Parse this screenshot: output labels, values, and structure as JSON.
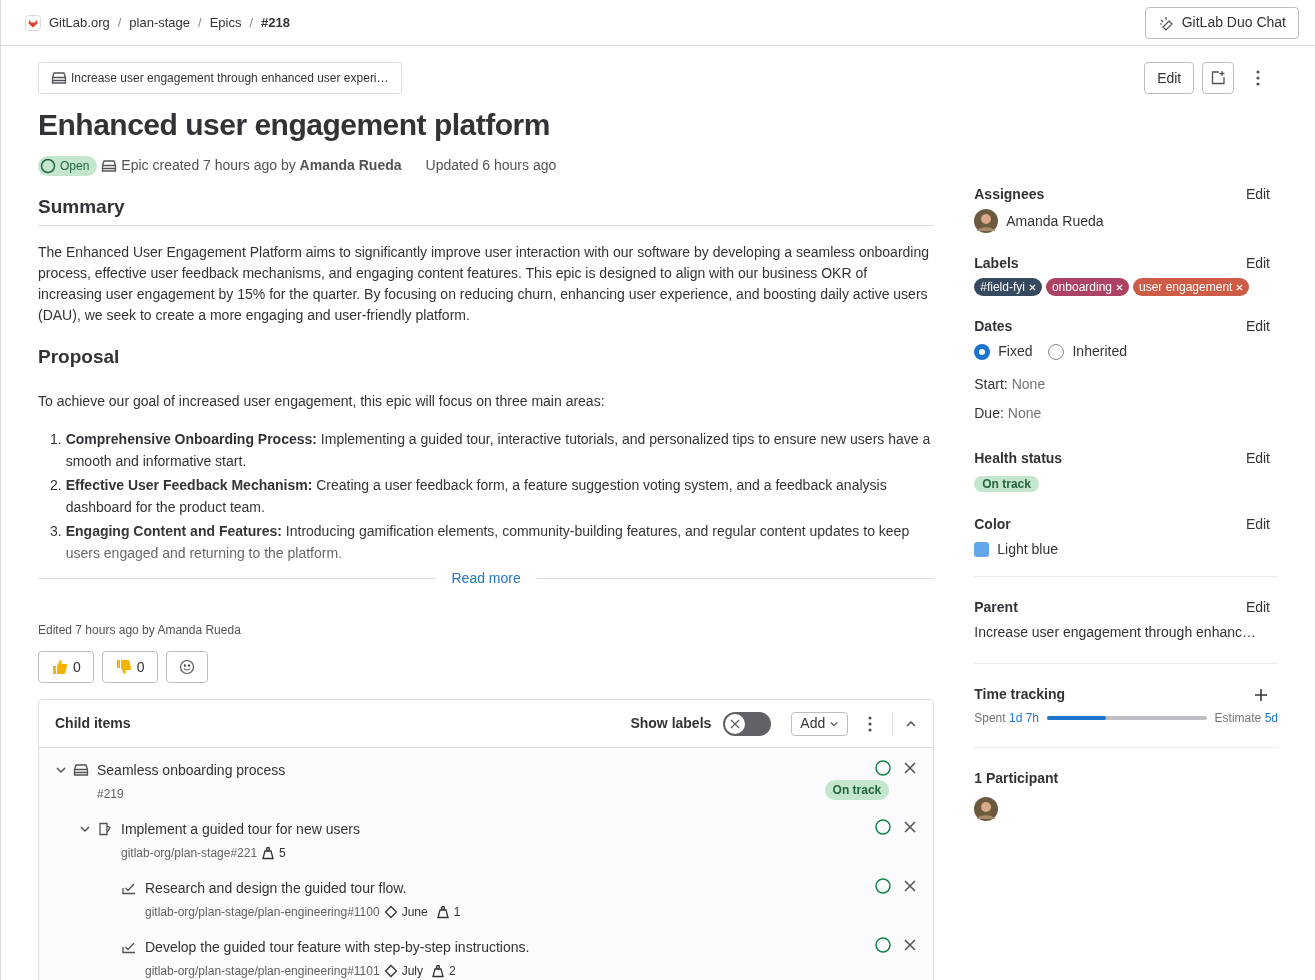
{
  "breadcrumbs": [
    {
      "label": "GitLab.org",
      "kind": "group"
    },
    {
      "label": "plan-stage",
      "kind": "link"
    },
    {
      "label": "Epics",
      "kind": "link"
    },
    {
      "label": "#218",
      "kind": "current"
    }
  ],
  "breadcrumb_separator": "/",
  "duo_button": "GitLab Duo Chat",
  "parent_chip": "Increase user engagement through enhanced user experi…",
  "actions": {
    "edit": "Edit"
  },
  "title": "Enhanced user engagement platform",
  "status": {
    "label": "Open"
  },
  "meta": {
    "created": "Epic created 7 hours ago by **Amanda Rueda**",
    "updated": "Updated 6 hours ago"
  },
  "description": [
    {
      "kind": "heading",
      "text": "Summary",
      "divider": true
    },
    {
      "kind": "paragraph",
      "text": "The Enhanced User Engagement Platform aims to significantly improve user interaction with our software by developing a seamless onboarding process, effective user feedback mechanisms, and engaging content features. This epic is designed to align with our business OKR of increasing user engagement by 15% for the quarter. By focusing on reducing churn, enhancing user experience, and boosting daily active users (DAU), we seek to create a more engaging and user-friendly platform."
    },
    {
      "kind": "heading",
      "text": "Proposal",
      "divider": false
    },
    {
      "kind": "paragraph",
      "text": "To achieve our goal of increased user engagement, this epic will focus on three main areas:"
    },
    {
      "kind": "list",
      "items": [
        {
          "num": "1.",
          "text": "**Comprehensive Onboarding Process:** Implementing a guided tour, interactive tutorials, and personalized tips to ensure new users have a smooth and informative start."
        },
        {
          "num": "2.",
          "text": "**Effective User Feedback Mechanism:** Creating a user feedback form, a feature suggestion voting system, and a feedback analysis dashboard for the product team."
        },
        {
          "num": "3.",
          "text": "**Engaging Content and Features:** Introducing gamification elements, community-building features, and regular content updates to keep users engaged and returning to the platform."
        }
      ]
    }
  ],
  "read_more": "Read more",
  "edited": "Edited 7 hours ago by Amanda Rueda",
  "reactions": [
    {
      "kind": "thumbsup",
      "count": "0"
    },
    {
      "kind": "thumbsdown",
      "count": "0"
    },
    {
      "kind": "add"
    }
  ],
  "child_items": {
    "title": "Child items",
    "show_labels": {
      "label": "Show labels",
      "on": false
    },
    "add": "Add",
    "items": [
      {
        "kind": "epic",
        "title": "Seamless onboarding process",
        "ref": "#219",
        "health": "On track",
        "expanded": true,
        "children": [
          {
            "kind": "issue",
            "title": "Implement a guided tour for new users",
            "ref": "gitlab-org/plan-stage#221",
            "weight": "5",
            "expanded": true,
            "children": [
              {
                "kind": "task",
                "title": "Research and design the guided tour flow.",
                "ref": "gitlab-org/plan-stage/plan-engineering#1100",
                "milestone": "June",
                "weight": "1"
              },
              {
                "kind": "task",
                "title": "Develop the guided tour feature with step-by-step instructions.",
                "ref": "gitlab-org/plan-stage/plan-engineering#1101",
                "milestone": "July",
                "weight": "2"
              }
            ]
          }
        ]
      }
    ]
  },
  "sidebar": {
    "assignees": {
      "title": "Assignees",
      "edit": "Edit",
      "name": "Amanda Rueda"
    },
    "labels": {
      "title": "Labels",
      "edit": "Edit",
      "items": [
        {
          "text": "#field-fyi",
          "color": "#36495f"
        },
        {
          "text": "onboarding",
          "color": "#ad4363"
        },
        {
          "text": "user engagement",
          "color": "#cd5b45"
        }
      ]
    },
    "dates": {
      "title": "Dates",
      "edit": "Edit",
      "options": [
        {
          "label": "Fixed",
          "selected": true
        },
        {
          "label": "Inherited",
          "selected": false
        }
      ],
      "start_label": "Start:",
      "start": "None",
      "due_label": "Due:",
      "due": "None"
    },
    "health": {
      "title": "Health status",
      "edit": "Edit",
      "value": "On track"
    },
    "color": {
      "title": "Color",
      "edit": "Edit",
      "name": "Light blue",
      "color": "#63a6e9"
    },
    "parent": {
      "title": "Parent",
      "edit": "Edit",
      "value": "Increase user engagement through enhanc…"
    },
    "time_tracking": {
      "title": "Time tracking",
      "spent_label": "Spent",
      "spent": "1d 7h",
      "level": 0.37,
      "estimate_label": "Estimate",
      "estimate": "5d"
    },
    "participants": {
      "title": "1 Participant"
    }
  }
}
